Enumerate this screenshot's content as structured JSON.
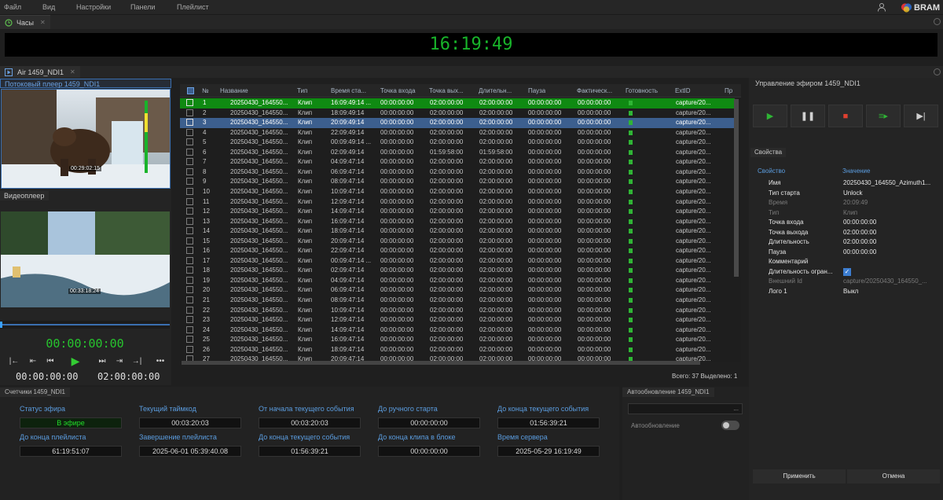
{
  "menu": [
    "Файл",
    "Вид",
    "Настройки",
    "Панели",
    "Плейлист"
  ],
  "brand": {
    "text": "BRAM"
  },
  "clock_panel": {
    "tab_label": "Часы",
    "time": "16:19:49"
  },
  "air_panel": {
    "tab_label": "Air 1459_NDI1",
    "stream_player_label": "Потоковый плеер 1459_NDI1",
    "stream_timecode": "00:29:02:15",
    "video_player_label": "Видеоплеер",
    "video_timecode": "00:33:18:24",
    "main_timecode": "00:00:00:00",
    "tc_in": "00:00:00:00",
    "tc_out": "02:00:00:00"
  },
  "playlist": {
    "columns": [
      "№",
      "Название",
      "Тип",
      "Время ста...",
      "Точка входа",
      "Точка вых...",
      "Длительн...",
      "Пауза",
      "Фактическ...",
      "Готовность",
      "ExtID",
      "Пр"
    ],
    "rows": [
      {
        "n": "1",
        "name": "20250430_164550...",
        "type": "Клип",
        "start": "16:09:49:14 ...",
        "in": "00:00:00:00",
        "out": "02:00:00:00",
        "dur": "02:00:00:00",
        "pause": "00:00:00:00",
        "fact": "00:00:00:00",
        "ext": "capture/20...",
        "state": "onair"
      },
      {
        "n": "2",
        "name": "20250430_164550...",
        "type": "Клип",
        "start": "18:09:49:14",
        "in": "00:00:00:00",
        "out": "02:00:00:00",
        "dur": "02:00:00:00",
        "pause": "00:00:00:00",
        "fact": "00:00:00:00",
        "ext": "capture/20..."
      },
      {
        "n": "3",
        "name": "20250430_164550...",
        "type": "Клип",
        "start": "20:09:49:14",
        "in": "00:00:00:00",
        "out": "02:00:00:00",
        "dur": "02:00:00:00",
        "pause": "00:00:00:00",
        "fact": "00:00:00:00",
        "ext": "capture/20...",
        "state": "selected"
      },
      {
        "n": "4",
        "name": "20250430_164550...",
        "type": "Клип",
        "start": "22:09:49:14",
        "in": "00:00:00:00",
        "out": "02:00:00:00",
        "dur": "02:00:00:00",
        "pause": "00:00:00:00",
        "fact": "00:00:00:00",
        "ext": "capture/20..."
      },
      {
        "n": "5",
        "name": "20250430_164550...",
        "type": "Клип",
        "start": "00:09:49:14 ...",
        "in": "00:00:00:00",
        "out": "02:00:00:00",
        "dur": "02:00:00:00",
        "pause": "00:00:00:00",
        "fact": "00:00:00:00",
        "ext": "capture/20..."
      },
      {
        "n": "6",
        "name": "20250430_164550...",
        "type": "Клип",
        "start": "02:09:49:14",
        "in": "00:00:00:00",
        "out": "01:59:58:00",
        "dur": "01:59:58:00",
        "pause": "00:00:00:00",
        "fact": "00:00:00:00",
        "ext": "capture/20..."
      },
      {
        "n": "7",
        "name": "20250430_164550...",
        "type": "Клип",
        "start": "04:09:47:14",
        "in": "00:00:00:00",
        "out": "02:00:00:00",
        "dur": "02:00:00:00",
        "pause": "00:00:00:00",
        "fact": "00:00:00:00",
        "ext": "capture/20..."
      },
      {
        "n": "8",
        "name": "20250430_164550...",
        "type": "Клип",
        "start": "06:09:47:14",
        "in": "00:00:00:00",
        "out": "02:00:00:00",
        "dur": "02:00:00:00",
        "pause": "00:00:00:00",
        "fact": "00:00:00:00",
        "ext": "capture/20..."
      },
      {
        "n": "9",
        "name": "20250430_164550...",
        "type": "Клип",
        "start": "08:09:47:14",
        "in": "00:00:00:00",
        "out": "02:00:00:00",
        "dur": "02:00:00:00",
        "pause": "00:00:00:00",
        "fact": "00:00:00:00",
        "ext": "capture/20..."
      },
      {
        "n": "10",
        "name": "20250430_164550...",
        "type": "Клип",
        "start": "10:09:47:14",
        "in": "00:00:00:00",
        "out": "02:00:00:00",
        "dur": "02:00:00:00",
        "pause": "00:00:00:00",
        "fact": "00:00:00:00",
        "ext": "capture/20..."
      },
      {
        "n": "11",
        "name": "20250430_164550...",
        "type": "Клип",
        "start": "12:09:47:14",
        "in": "00:00:00:00",
        "out": "02:00:00:00",
        "dur": "02:00:00:00",
        "pause": "00:00:00:00",
        "fact": "00:00:00:00",
        "ext": "capture/20..."
      },
      {
        "n": "12",
        "name": "20250430_164550...",
        "type": "Клип",
        "start": "14:09:47:14",
        "in": "00:00:00:00",
        "out": "02:00:00:00",
        "dur": "02:00:00:00",
        "pause": "00:00:00:00",
        "fact": "00:00:00:00",
        "ext": "capture/20..."
      },
      {
        "n": "13",
        "name": "20250430_164550...",
        "type": "Клип",
        "start": "16:09:47:14",
        "in": "00:00:00:00",
        "out": "02:00:00:00",
        "dur": "02:00:00:00",
        "pause": "00:00:00:00",
        "fact": "00:00:00:00",
        "ext": "capture/20..."
      },
      {
        "n": "14",
        "name": "20250430_164550...",
        "type": "Клип",
        "start": "18:09:47:14",
        "in": "00:00:00:00",
        "out": "02:00:00:00",
        "dur": "02:00:00:00",
        "pause": "00:00:00:00",
        "fact": "00:00:00:00",
        "ext": "capture/20..."
      },
      {
        "n": "15",
        "name": "20250430_164550...",
        "type": "Клип",
        "start": "20:09:47:14",
        "in": "00:00:00:00",
        "out": "02:00:00:00",
        "dur": "02:00:00:00",
        "pause": "00:00:00:00",
        "fact": "00:00:00:00",
        "ext": "capture/20..."
      },
      {
        "n": "16",
        "name": "20250430_164550...",
        "type": "Клип",
        "start": "22:09:47:14",
        "in": "00:00:00:00",
        "out": "02:00:00:00",
        "dur": "02:00:00:00",
        "pause": "00:00:00:00",
        "fact": "00:00:00:00",
        "ext": "capture/20..."
      },
      {
        "n": "17",
        "name": "20250430_164550...",
        "type": "Клип",
        "start": "00:09:47:14 ...",
        "in": "00:00:00:00",
        "out": "02:00:00:00",
        "dur": "02:00:00:00",
        "pause": "00:00:00:00",
        "fact": "00:00:00:00",
        "ext": "capture/20..."
      },
      {
        "n": "18",
        "name": "20250430_164550...",
        "type": "Клип",
        "start": "02:09:47:14",
        "in": "00:00:00:00",
        "out": "02:00:00:00",
        "dur": "02:00:00:00",
        "pause": "00:00:00:00",
        "fact": "00:00:00:00",
        "ext": "capture/20..."
      },
      {
        "n": "19",
        "name": "20250430_164550...",
        "type": "Клип",
        "start": "04:09:47:14",
        "in": "00:00:00:00",
        "out": "02:00:00:00",
        "dur": "02:00:00:00",
        "pause": "00:00:00:00",
        "fact": "00:00:00:00",
        "ext": "capture/20..."
      },
      {
        "n": "20",
        "name": "20250430_164550...",
        "type": "Клип",
        "start": "06:09:47:14",
        "in": "00:00:00:00",
        "out": "02:00:00:00",
        "dur": "02:00:00:00",
        "pause": "00:00:00:00",
        "fact": "00:00:00:00",
        "ext": "capture/20..."
      },
      {
        "n": "21",
        "name": "20250430_164550...",
        "type": "Клип",
        "start": "08:09:47:14",
        "in": "00:00:00:00",
        "out": "02:00:00:00",
        "dur": "02:00:00:00",
        "pause": "00:00:00:00",
        "fact": "00:00:00:00",
        "ext": "capture/20..."
      },
      {
        "n": "22",
        "name": "20250430_164550...",
        "type": "Клип",
        "start": "10:09:47:14",
        "in": "00:00:00:00",
        "out": "02:00:00:00",
        "dur": "02:00:00:00",
        "pause": "00:00:00:00",
        "fact": "00:00:00:00",
        "ext": "capture/20..."
      },
      {
        "n": "23",
        "name": "20250430_164550...",
        "type": "Клип",
        "start": "12:09:47:14",
        "in": "00:00:00:00",
        "out": "02:00:00:00",
        "dur": "02:00:00:00",
        "pause": "00:00:00:00",
        "fact": "00:00:00:00",
        "ext": "capture/20..."
      },
      {
        "n": "24",
        "name": "20250430_164550...",
        "type": "Клип",
        "start": "14:09:47:14",
        "in": "00:00:00:00",
        "out": "02:00:00:00",
        "dur": "02:00:00:00",
        "pause": "00:00:00:00",
        "fact": "00:00:00:00",
        "ext": "capture/20..."
      },
      {
        "n": "25",
        "name": "20250430_164550...",
        "type": "Клип",
        "start": "16:09:47:14",
        "in": "00:00:00:00",
        "out": "02:00:00:00",
        "dur": "02:00:00:00",
        "pause": "00:00:00:00",
        "fact": "00:00:00:00",
        "ext": "capture/20..."
      },
      {
        "n": "26",
        "name": "20250430_164550...",
        "type": "Клип",
        "start": "18:09:47:14",
        "in": "00:00:00:00",
        "out": "02:00:00:00",
        "dur": "02:00:00:00",
        "pause": "00:00:00:00",
        "fact": "00:00:00:00",
        "ext": "capture/20..."
      },
      {
        "n": "27",
        "name": "20250430_164550...",
        "type": "Клип",
        "start": "20:09:47:14",
        "in": "00:00:00:00",
        "out": "02:00:00:00",
        "dur": "02:00:00:00",
        "pause": "00:00:00:00",
        "fact": "00:00:00:00",
        "ext": "capture/20..."
      }
    ],
    "footer": "Всего: 37 Выделено: 1"
  },
  "counters": {
    "title": "Счетчики 1459_NDI1",
    "items": [
      {
        "label": "Статус эфира",
        "value": "В эфире"
      },
      {
        "label": "Текущий таймкод",
        "value": "00:03:20:03"
      },
      {
        "label": "От начала текущего события",
        "value": "00:03:20:03"
      },
      {
        "label": "До ручного старта",
        "value": "00:00:00:00"
      },
      {
        "label": "До конца текущего события",
        "value": "01:56:39:21"
      },
      {
        "label": "До конца плейлиста",
        "value": "61:19:51:07"
      },
      {
        "label": "Завершение плейлиста",
        "value": "2025-06-01 05:39:40.08"
      },
      {
        "label": "До конца текущего события",
        "value": "01:56:39:21"
      },
      {
        "label": "До конца клипа в блоке",
        "value": "00:00:00:00"
      },
      {
        "label": "Время сервера",
        "value": "2025-05-29 16:19:49"
      }
    ]
  },
  "autorefresh": {
    "title": "Автообновление 1459_NDI1",
    "input_value": "...",
    "toggle_label": "Автообновление",
    "enabled": false
  },
  "air_control": {
    "title": "Управление эфиром 1459_NDI1"
  },
  "properties": {
    "title": "Свойства",
    "col_key": "Свойство",
    "col_value": "Значение",
    "rows": [
      {
        "k": "Имя",
        "v": "20250430_164550_Azimuth1...",
        "dim": false
      },
      {
        "k": "Тип старта",
        "v": "Unlock",
        "dim": false
      },
      {
        "k": "Время",
        "v": "20:09:49",
        "dim": true
      },
      {
        "k": "Тип",
        "v": "Клип",
        "dim": true
      },
      {
        "k": "Точка входа",
        "v": "00:00:00:00",
        "dim": false
      },
      {
        "k": "Точка выхода",
        "v": "02:00:00:00",
        "dim": false
      },
      {
        "k": "Длительность",
        "v": "02:00:00:00",
        "dim": false
      },
      {
        "k": "Пауза",
        "v": "00:00:00:00",
        "dim": false
      },
      {
        "k": "Комментарий",
        "v": "",
        "dim": false
      },
      {
        "k": "Длительность огран...",
        "v": "",
        "dim": false
      },
      {
        "k": "Внешний Id",
        "v": "capture/20250430_164550_...",
        "dim": true
      },
      {
        "k": "Лого 1",
        "v": "Выкл",
        "dim": false
      }
    ],
    "apply_label": "Применить",
    "cancel_label": "Отмена"
  },
  "colors": {
    "onair_row": "#0f8a12",
    "selected_row": "#3c5f8e",
    "accent": "#5b9de0",
    "timecode_green": "#18b42a"
  }
}
